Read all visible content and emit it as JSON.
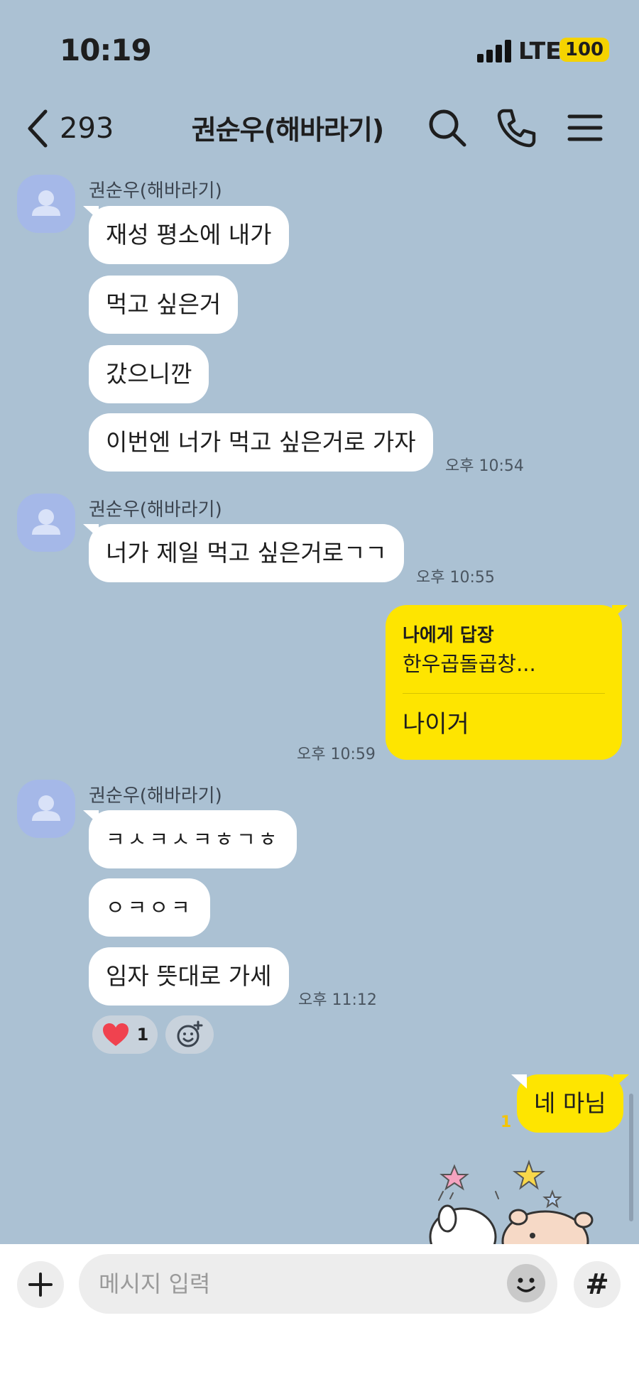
{
  "status_bar": {
    "time": "10:19",
    "carrier": "LTE",
    "battery": "100"
  },
  "header": {
    "back_count": "293",
    "title": "권순우(해바라기)"
  },
  "groups": [
    {
      "sender": "권순우(해바라기)",
      "messages": [
        "재성 평소에 내가",
        "먹고 싶은거",
        "갔으니깐",
        "이번엔 너가 먹고 싶은거로 가자"
      ],
      "time": "오후 10:54"
    },
    {
      "sender": "권순우(해바라기)",
      "messages": [
        "너가 제일 먹고 싶은거로ㄱㄱ"
      ],
      "time": "오후 10:55"
    },
    {
      "sender": "권순우(해바라기)",
      "messages": [
        "ㅋㅅㅋㅅㅋㅎㄱㅎ",
        "ㅇㅋㅇㅋ",
        "임자 뜻대로 가세"
      ],
      "time": "오후 11:12"
    }
  ],
  "my_reply": {
    "reply_to": "나에게 답장",
    "quoted": "한우곱돌곱창...",
    "text": "나이거",
    "time": "오후 10:59"
  },
  "reaction": {
    "icon": "heart-icon",
    "count": "1"
  },
  "my_last": {
    "text": "네 마님",
    "unread": "1"
  },
  "input": {
    "placeholder": "메시지 입력",
    "value": ""
  },
  "colors": {
    "background": "#abc1d3",
    "my_bubble": "#fee500",
    "their_bubble": "#ffffff",
    "avatar": "#a5b8e8",
    "unread": "#f5c400"
  }
}
